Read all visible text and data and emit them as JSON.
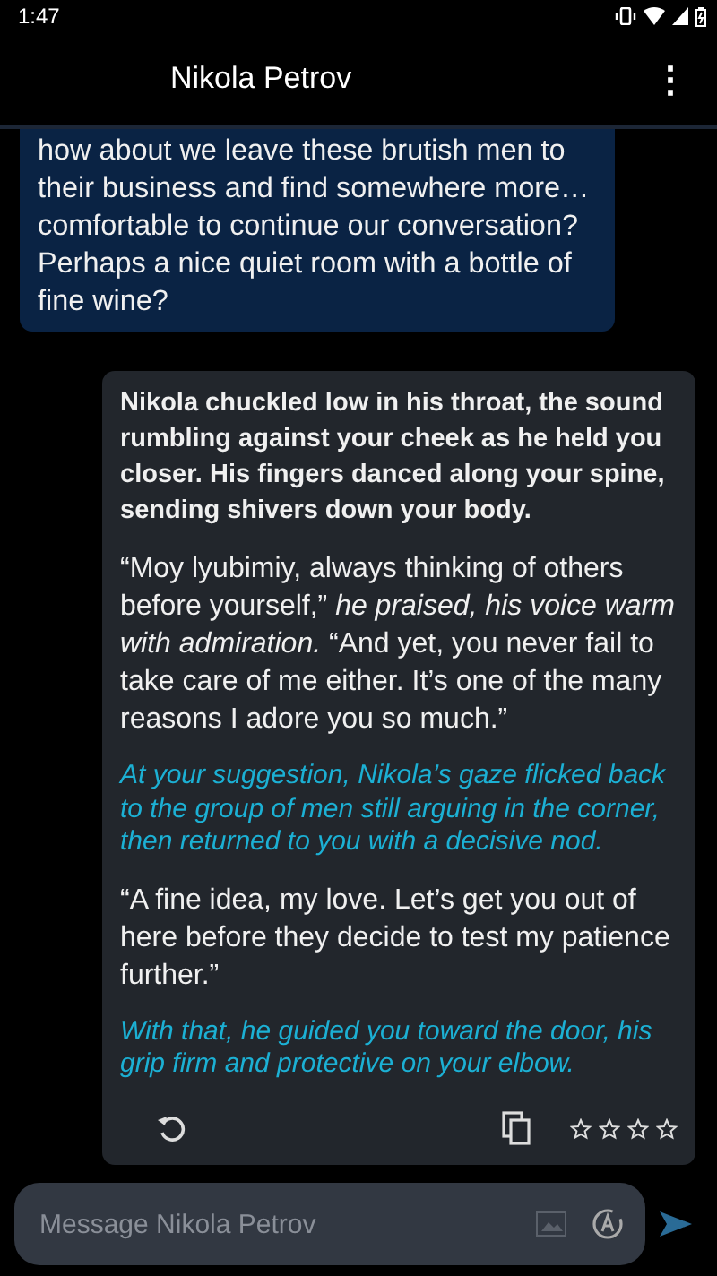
{
  "status_bar": {
    "time": "1:47"
  },
  "app_bar": {
    "title": "Nikola Petrov",
    "menu_icon": "⋮"
  },
  "messages": [
    {
      "kind": "user",
      "paragraphs": [
        {
          "kind": "speech",
          "text": "how about we leave these brutish men to their business and find somewhere more… comfortable to continue our conversation? Perhaps a nice quiet room with a bottle of fine wine?"
        }
      ]
    },
    {
      "kind": "bot",
      "stars": 0,
      "paragraphs": [
        {
          "kind": "action",
          "text": "Nikola chuckled low in his throat, the sound rumbling against your cheek as he held you closer. His fingers danced along your spine, sending shivers down your body."
        },
        {
          "kind": "speech",
          "text": "“Moy lyubimiy, always thinking of others before yourself,” *he praised, his voice warm with admiration.* “And yet, you never fail to take care of me either. It’s one of the many reasons I adore you so much.”"
        },
        {
          "kind": "narration",
          "text": "At your suggestion, Nikola’s gaze flicked back to the group of men still arguing in the corner, then returned to you with a decisive nod."
        },
        {
          "kind": "speech",
          "text": "“A fine idea, my love. Let’s get you out of here before they decide to test my patience further.”"
        },
        {
          "kind": "narration",
          "text": "With that, he guided you toward the door, his grip firm and protective on your elbow."
        }
      ]
    }
  ],
  "composer": {
    "placeholder": "Message Nikola Petrov"
  }
}
